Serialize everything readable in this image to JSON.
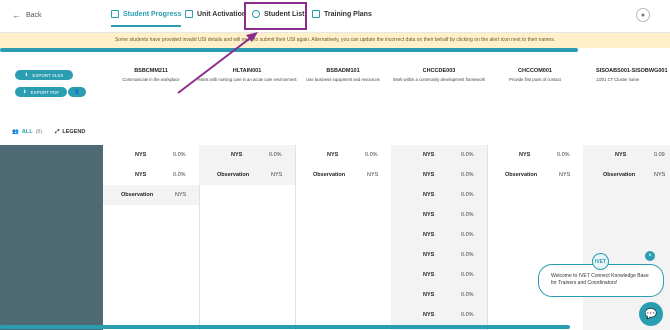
{
  "nav": {
    "back_label": "Back",
    "tabs": [
      {
        "label": "Student Progress",
        "icon": "chart-icon"
      },
      {
        "label": "Unit Activation",
        "icon": "unit-icon"
      },
      {
        "label": "Student List",
        "icon": "users-icon"
      },
      {
        "label": "Training Plans",
        "icon": "plans-icon"
      }
    ],
    "active_tab": "Student Progress"
  },
  "alert": {
    "text": "Some students have provided invalid USI details and will need to submit their USI again. Alternatively, you can update the incorrect data on their behalf by clicking on the alert icon next to their names."
  },
  "actions": {
    "export_xlsx": "EXPORT XLSX",
    "export_pdf": "EXPORT PDF"
  },
  "units": [
    {
      "code": "BSBCMM211",
      "desc": "Communicate in the workplace"
    },
    {
      "code": "HLTAIN001",
      "desc": "Assist with nursing care in an acute care environment"
    },
    {
      "code": "BSBADM101",
      "desc": "Use business equipment and resources"
    },
    {
      "code": "CHCCDE003",
      "desc": "Work within a community development framework"
    },
    {
      "code": "CHCCOM001",
      "desc": "Provide first point of contact"
    },
    {
      "code": "SISOABS001-SISOBWG001",
      "desc": "13/01 CT Cluster name"
    }
  ],
  "filters": {
    "all_label": "ALL",
    "all_count": "(8)",
    "legend_label": "LEGEND"
  },
  "grid": {
    "col1": [
      {
        "label": "NYS",
        "value": "0.0%"
      },
      {
        "label": "NYS",
        "value": "0.0%"
      },
      {
        "label": "Observation",
        "value": "NYS"
      }
    ],
    "col2": [
      {
        "label": "NYS",
        "value": "0.0%"
      },
      {
        "label": "Observation",
        "value": "NYS"
      }
    ],
    "col3": [
      {
        "label": "NYS",
        "value": "0.0%"
      },
      {
        "label": "Observation",
        "value": "NYS"
      }
    ],
    "col4": [
      {
        "label": "NYS",
        "value": "0.0%"
      },
      {
        "label": "NYS",
        "value": "0.0%"
      },
      {
        "label": "NYS",
        "value": "0.0%"
      },
      {
        "label": "NYS",
        "value": "0.0%"
      },
      {
        "label": "NYS",
        "value": "0.0%"
      },
      {
        "label": "NYS",
        "value": "0.0%"
      },
      {
        "label": "NYS",
        "value": "0.0%"
      },
      {
        "label": "NYS",
        "value": "0.0%"
      },
      {
        "label": "NYS",
        "value": "0.0%"
      }
    ],
    "col5": [
      {
        "label": "NYS",
        "value": "0.0%"
      },
      {
        "label": "Observation",
        "value": "NYS"
      }
    ],
    "col6": [
      {
        "label": "NYS",
        "value": "0.09"
      },
      {
        "label": "Observation",
        "value": "NYS"
      }
    ]
  },
  "chat": {
    "message": "Welcome to IVET Connect Knowledge Base for Trainers and Coordinators!",
    "avatar_text": "IVET"
  },
  "colors": {
    "accent": "#2a9db1",
    "highlight": "#8c2c8c",
    "alert_bg": "#fff0c9",
    "left_panel": "#4e6b75"
  }
}
